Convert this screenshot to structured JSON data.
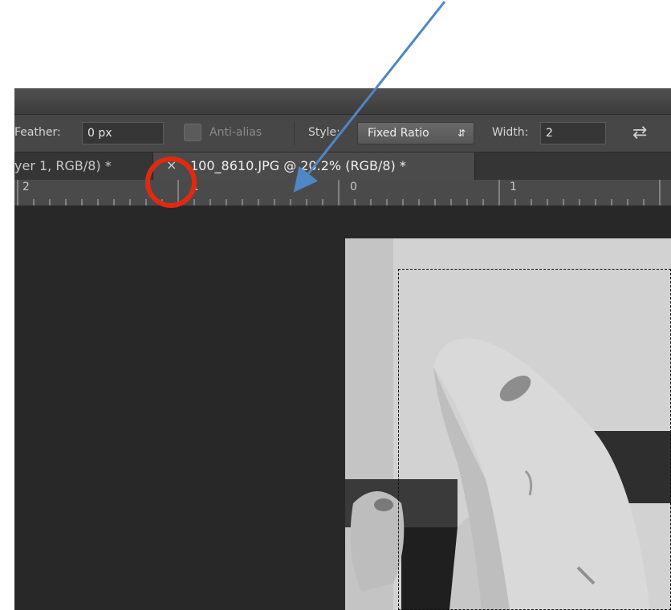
{
  "options_bar": {
    "feather_label": "Feather:",
    "feather_value": "0 px",
    "antialias_label": "Anti-alias",
    "style_label": "Style:",
    "style_value": "Fixed Ratio",
    "width_label": "Width:",
    "width_value": "2"
  },
  "tabs": [
    {
      "label": "yer 1, RGB/8) *"
    },
    {
      "label": "100_8610.JPG @ 20.2% (RGB/8) *",
      "close": "×"
    }
  ],
  "ruler": {
    "labels": [
      "2",
      "1",
      "0",
      "1"
    ]
  },
  "icons": {
    "tab_close": "close-icon",
    "style_arrows": "up-down-arrows-icon",
    "swap": "swap-arrows-icon",
    "antialias_checkbox": "checkbox-icon"
  },
  "colors": {
    "annotation_circle": "#e02a10",
    "annotation_arrow": "#4f86c6"
  }
}
